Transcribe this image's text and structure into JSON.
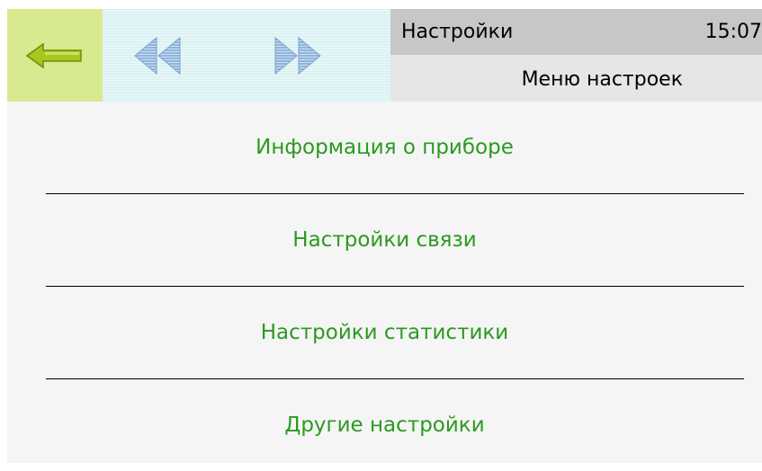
{
  "header": {
    "title": "Настройки",
    "clock": "15:07",
    "subtitle": "Меню настроек",
    "back_icon": "arrow-left-icon",
    "prev_icon": "double-triangle-left-icon",
    "next_icon": "double-triangle-right-icon"
  },
  "menu": {
    "items": [
      {
        "label": "Информация о приборе"
      },
      {
        "label": "Настройки связи"
      },
      {
        "label": "Настройки статистики"
      },
      {
        "label": "Другие настройки"
      }
    ]
  },
  "colors": {
    "accent_text": "#2b9a1f",
    "back_button_bg": "#d8ea8f",
    "nav_bg": "#e4f6f6",
    "title_bar_bg": "#c7c7c7",
    "subtitle_bar_bg": "#e6e6e6"
  }
}
